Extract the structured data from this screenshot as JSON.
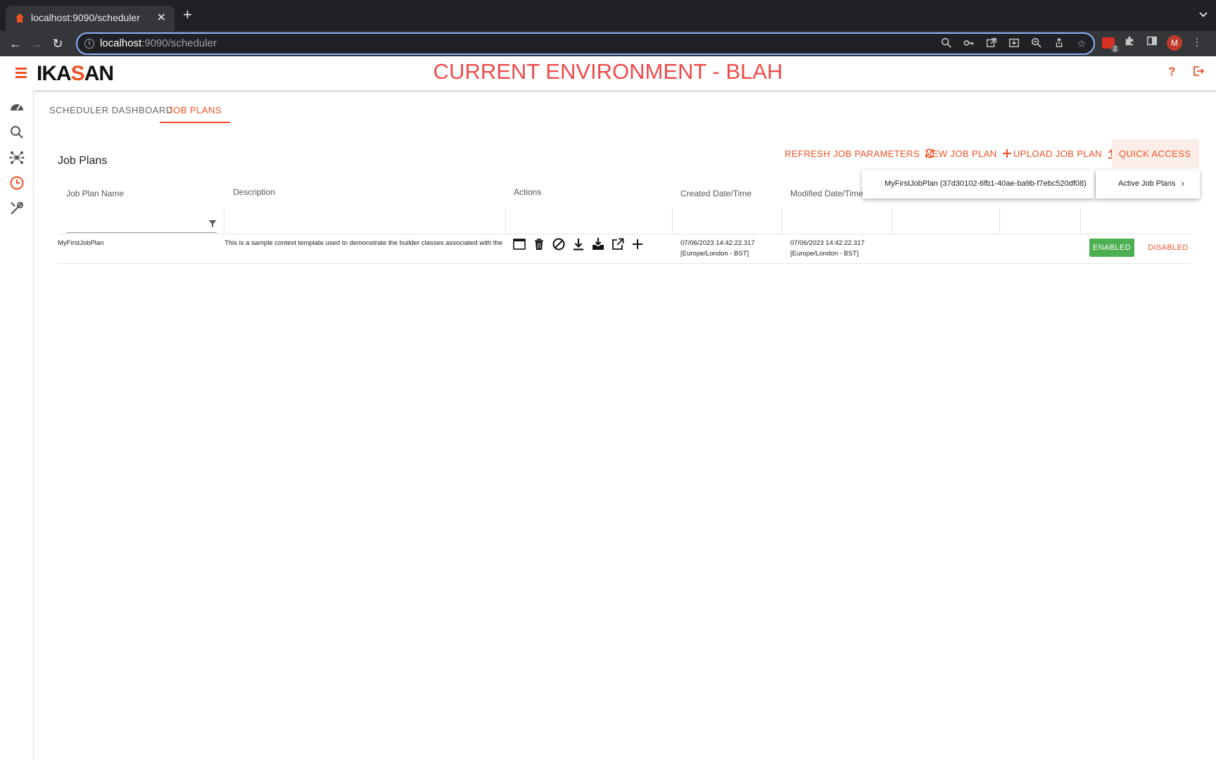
{
  "browser": {
    "tab_title": "localhost:9090/scheduler",
    "url_host": "localhost",
    "url_path": ":9090/scheduler",
    "extension_badge": "2",
    "profile_initial": "M"
  },
  "header": {
    "logo_text_1": "IKA",
    "logo_text_2": "S",
    "logo_text_3": "AN",
    "environment": "CURRENT ENVIRONMENT - BLAH",
    "accent_color": "#ef5125"
  },
  "tabs": [
    {
      "label": "SCHEDULER DASHBOARD",
      "active": false
    },
    {
      "label": "JOB PLANS",
      "active": true
    }
  ],
  "page": {
    "title": "Job Plans",
    "refresh_label": "REFRESH JOB PARAMETERS",
    "new_label": "NEW JOB PLAN",
    "upload_label": "UPLOAD JOB PLAN",
    "quick_access_label": "QUICK ACCESS",
    "quick_menu_item": "Active Job Plans",
    "quick_submenu_item": "MyFirstJobPlan (37d30102-6fb1-40ae-ba9b-f7ebc520df08)"
  },
  "table": {
    "headers": {
      "name": "Job Plan Name",
      "description": "Description",
      "actions": "Actions",
      "created": "Created Date/Time",
      "modified": "Modified Date/Time"
    },
    "rows": [
      {
        "name": "MyFirstJobPlan",
        "description": "This is a sample context template used to demonstrate the builder classes associated with the Ikasa",
        "created_date": "07/06/2023 14:42:22.317",
        "created_tz": "[Europe/London - BST]",
        "modified_date": "07/06/2023 14:42:22.317",
        "modified_tz": "[Europe/London - BST]",
        "enabled_label": "ENABLED",
        "disabled_label": "DISABLED"
      }
    ]
  }
}
